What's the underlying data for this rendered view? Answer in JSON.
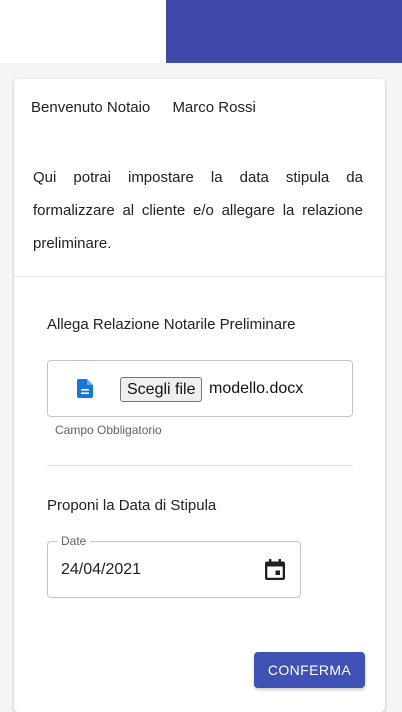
{
  "colors": {
    "primary": "#3f51b5",
    "header": "#3f4aa8",
    "file_icon": "#1976d2"
  },
  "card": {
    "welcome_label": "Benvenuto Notaio",
    "user_name": "Marco Rossi",
    "intro_text": "Qui potrai impostare la data stipula da formalizzare al cliente e/o allegare la relazione preliminare."
  },
  "attachment": {
    "title": "Allega Relazione Notarile Preliminare",
    "icon": "document-icon",
    "choose_button": "Scegli file",
    "file_name": "modello.docx",
    "hint": "Campo Obbligatorio"
  },
  "stipula": {
    "title": "Proponi la Data di Stipula",
    "date_label": "Date",
    "date_value": "24/04/2021",
    "icon": "calendar-icon"
  },
  "actions": {
    "confirm_label": "CONFERMA"
  }
}
